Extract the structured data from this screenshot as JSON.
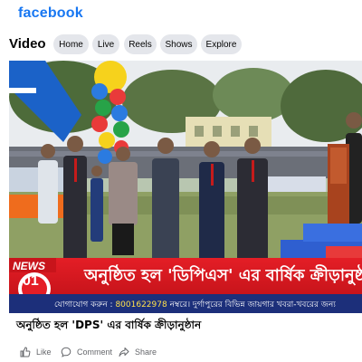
{
  "header": {
    "logo": "facebook"
  },
  "nav": {
    "title": "Video",
    "tabs": [
      "Home",
      "Live",
      "Reels",
      "Shows",
      "Explore"
    ]
  },
  "video": {
    "channel_logo": "NEWS",
    "channel_number": "01",
    "headline": "অনুষ্ঠিত হল 'ডিপিএস' এর বার্ষিক ক্রীড়ানুষ্ঠান",
    "subticker_prefix": "যোগাযোগ করুন : ",
    "subticker_phone": "8001622978",
    "subticker_rest": " নম্বরে। দুর্গাপুরের বিভিন্ন জায়গার খবরা-খবরের জন্য"
  },
  "post": {
    "caption": "অনুষ্ঠিত হল 'DPS' এর বার্ষিক ক্রীড়ানুষ্ঠান"
  },
  "actions": {
    "like": "Like",
    "comment": "Comment",
    "share": "Share"
  },
  "colors": {
    "brand": "#1877f2",
    "ticker_red": "#e41e26",
    "ticker_blue": "#1c2f7a"
  }
}
